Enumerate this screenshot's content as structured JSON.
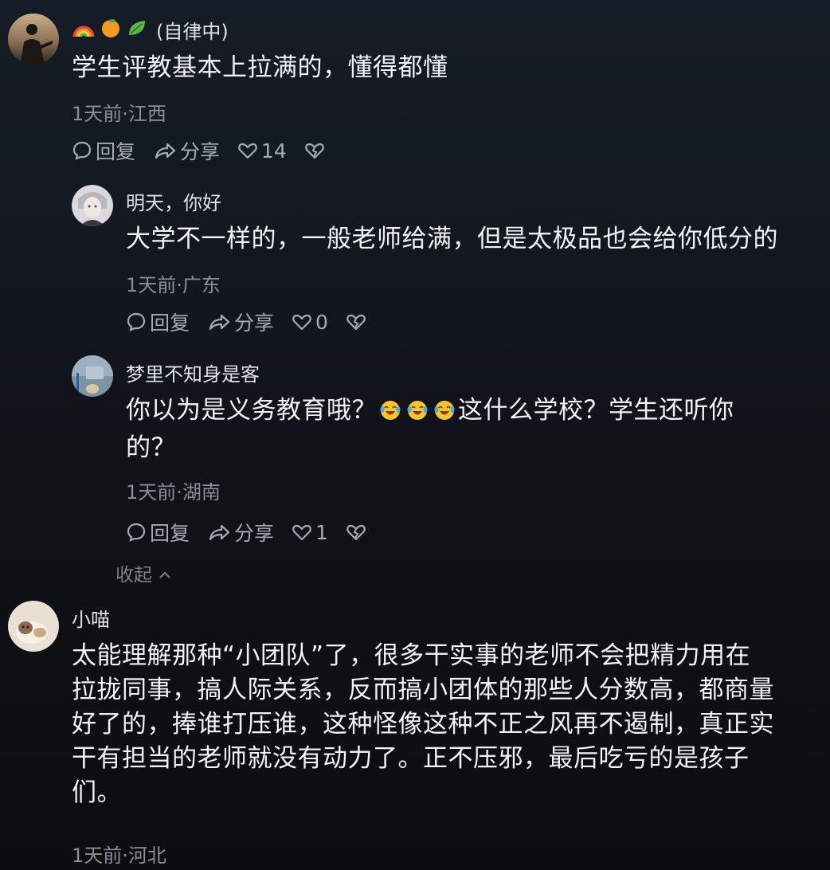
{
  "comments": [
    {
      "username": "(自律中)",
      "username_emojis": [
        "rainbow-icon",
        "orange-icon",
        "leaf-icon"
      ],
      "text": "学生评教基本上拉满的，懂得都懂",
      "meta": "1天前·江西",
      "reply_label": "回复",
      "share_label": "分享",
      "likes": "14"
    },
    {
      "username": "明天，你好",
      "text": "大学不一样的，一般老师给满，但是太极品也会给你低分的",
      "meta": "1天前·广东",
      "reply_label": "回复",
      "share_label": "分享",
      "likes": "0"
    },
    {
      "username": "梦里不知身是客",
      "text_part1": "你以为是义务教育哦？",
      "text_part2": "这什么学校？学生还听你",
      "text_part3": "的？",
      "inline_emojis": [
        "laughing-tears-icon",
        "laughing-tears-icon",
        "laughing-tears-icon"
      ],
      "meta": "1天前·湖南",
      "reply_label": "回复",
      "share_label": "分享",
      "likes": "1"
    },
    {
      "username": "小喵",
      "text_lines": [
        "太能理解那种“小团队”了，很多干实事的老师不会把精力用在",
        "拉拢同事，搞人际关系，反而搞小团体的那些人分数高，都商量",
        "好了的，捧谁打压谁，这种怪像这种不正之风再不遏制，真正实",
        "干有担当的老师就没有动力了。正不压邪，最后吃亏的是孩子",
        "们。"
      ],
      "meta": "1天前·河北"
    }
  ],
  "collapse_label": "收起",
  "colors": {
    "background_top": "#161c27",
    "background_bottom": "#0c0d10",
    "text": "#f1f2f5",
    "meta": "#8a8f99",
    "action": "#a6abb4"
  }
}
